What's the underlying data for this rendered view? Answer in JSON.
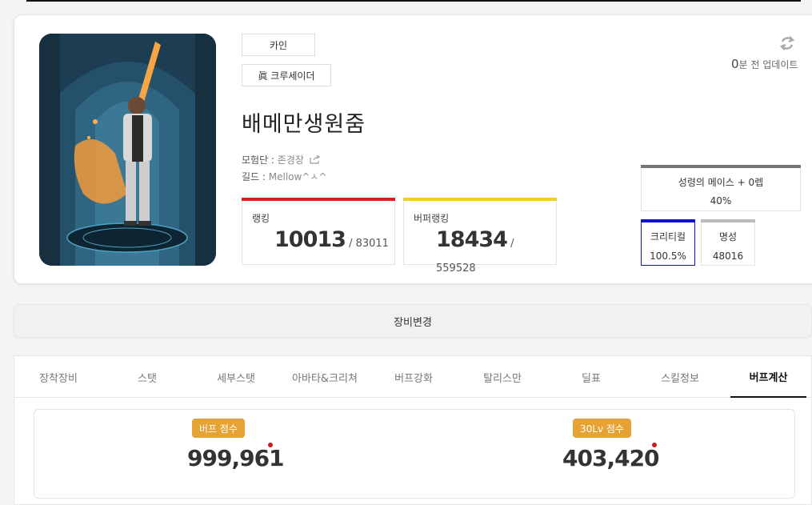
{
  "character": {
    "server": "카인",
    "job": "眞 크루세이더",
    "name": "배메만생원줌",
    "adventure_label": "모험단 : ",
    "adventure_value": "존경장",
    "guild_label": "길드 : ",
    "guild_value": "Mellow^ㅅ^"
  },
  "update": {
    "minutes": "0",
    "suffix": "분 전 업데이트"
  },
  "rankings": [
    {
      "label": "랭킹",
      "value": "10013",
      "total": " / 83011",
      "color": "#d32020"
    },
    {
      "label": "버퍼랭킹",
      "value": "18434",
      "total": " / 559528",
      "color": "#f0d020"
    }
  ],
  "equipment": {
    "title": "성령의 메이스 + 0렙",
    "value": "40%"
  },
  "stats": [
    {
      "label": "크리티컬",
      "value": "100.5%",
      "color": "#1010d0"
    },
    {
      "label": "명성",
      "value": "48016",
      "color": "#bbbbbb"
    }
  ],
  "change_equip_label": "장비변경",
  "tabs": [
    "장착장비",
    "스탯",
    "세부스탯",
    "아바타&크리쳐",
    "버프강화",
    "탈리스만",
    "딜표",
    "스킬정보",
    "버프계산"
  ],
  "active_tab": "버프계산",
  "scores": [
    {
      "badge": "버프 점수",
      "value": "999,961"
    },
    {
      "badge": "30Lv 점수",
      "value": "403,420"
    }
  ],
  "icons": {
    "refresh": "refresh-icon",
    "external": "external-link-icon"
  }
}
